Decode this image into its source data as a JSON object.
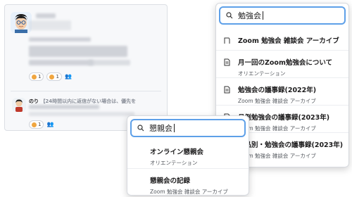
{
  "chat": {
    "reactions_top": [
      {
        "count": "1"
      },
      {
        "count": "1"
      }
    ],
    "reactions_bottom": [
      {
        "count": "1"
      }
    ],
    "message_author": "のり",
    "message_text": "【24時間以内に返信がない場合は、優先を"
  },
  "right_panel": {
    "search_value": "勉強会",
    "results": [
      {
        "icon": "channel-icon",
        "title": "Zoom 勉強会 雑談会 アーカイブ",
        "sub": ""
      },
      {
        "icon": "document-icon",
        "title": "月一回のZoom勉強会について",
        "sub": "オリエンテーション"
      },
      {
        "icon": "document-icon",
        "title": "勉強会の議事録(2022年)",
        "sub": "Zoom 勉強会 雑談会 アーカイブ"
      },
      {
        "icon": "document-icon",
        "title": "月例勉強会の議事録(2023年)",
        "sub": "Zoom 勉強会 雑談会 アーカイブ"
      },
      {
        "icon": "document-icon",
        "title": "商品別・勉強会の議事録(2023年)",
        "sub": "Zoom 勉強会 雑談会 アーカイブ"
      }
    ]
  },
  "front_panel": {
    "search_value": "懇親会",
    "results": [
      {
        "title": "オンライン懇親会",
        "sub": "オリエンテーション"
      },
      {
        "title": "懇親会の記録",
        "sub": "Zoom 勉強会 雑談会 アーカイブ"
      }
    ]
  },
  "colors": {
    "focus_border": "#5ea0e8",
    "reaction_emoji": "#f0a640"
  }
}
